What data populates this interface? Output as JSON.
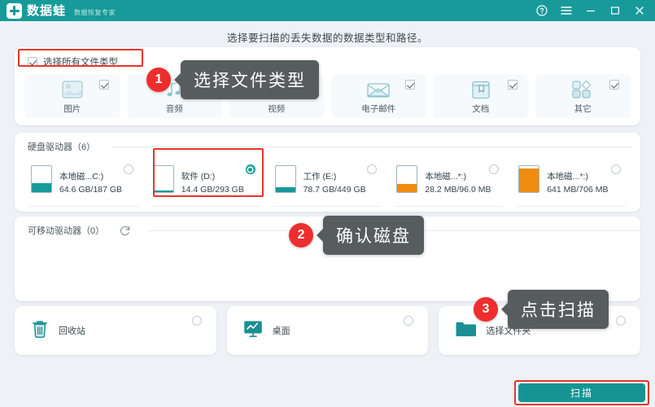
{
  "titlebar": {
    "logo_text": "数据蛙",
    "logo_subtitle": "数据恢复专家",
    "brand_color": "#189a9a",
    "buttons": [
      {
        "name": "help-icon",
        "label": "?"
      },
      {
        "name": "menu-icon",
        "label": "≡"
      },
      {
        "name": "minimize-button",
        "label": "–"
      },
      {
        "name": "maximize-button",
        "label": "□"
      },
      {
        "name": "close-button",
        "label": "✕"
      }
    ]
  },
  "page": {
    "subtitle": "选择要扫描的丢失数据的数据类型和路径。",
    "background": "#eef2f6"
  },
  "filetypes": {
    "select_all_label": "选择所有文件类型",
    "select_all_checked": true,
    "highlight_color": "#e8342a",
    "items": [
      {
        "label": "图片",
        "icon": "image-icon",
        "checked": true
      },
      {
        "label": "音频",
        "icon": "audio-icon",
        "checked": true
      },
      {
        "label": "视频",
        "icon": "video-icon",
        "checked": true
      },
      {
        "label": "电子邮件",
        "icon": "email-icon",
        "checked": true
      },
      {
        "label": "文档",
        "icon": "document-icon",
        "checked": true
      },
      {
        "label": "其它",
        "icon": "other-icon",
        "checked": true
      }
    ]
  },
  "drives": {
    "section_label": "硬盘驱动器（6）",
    "items": [
      {
        "name": "本地磁...C:)",
        "size": "64.6 GB/187 GB",
        "selected": false,
        "fill_pct": 35,
        "fill_color": "#189a9a"
      },
      {
        "name": "软件 (D:)",
        "size": "14.4 GB/293 GB",
        "selected": true,
        "fill_pct": 5,
        "fill_color": "#189a9a"
      },
      {
        "name": "工作 (E:)",
        "size": "78.7 GB/449 GB",
        "selected": false,
        "fill_pct": 18,
        "fill_color": "#189a9a"
      },
      {
        "name": "本地磁...*:)",
        "size": "28.2 MB/96.0 MB",
        "selected": false,
        "fill_pct": 30,
        "fill_color": "#f08c10"
      },
      {
        "name": "本地磁...*:)",
        "size": "641 MB/706 MB",
        "selected": false,
        "fill_pct": 92,
        "fill_color": "#f08c10"
      }
    ]
  },
  "removable": {
    "section_label": "可移动驱动器（0）",
    "refresh_icon": "refresh-icon"
  },
  "locations": [
    {
      "label": "回收站",
      "icon": "recycle-bin-icon",
      "selected": false
    },
    {
      "label": "桌面",
      "icon": "desktop-icon",
      "selected": false
    },
    {
      "label": "选择文件夹",
      "icon": "folder-icon",
      "selected": false
    }
  ],
  "scan": {
    "label": "扫描",
    "color": "#169494",
    "highlight_color": "#e8342a"
  },
  "callouts": [
    {
      "number": "1",
      "text": "选择文件类型"
    },
    {
      "number": "2",
      "text": "确认磁盘"
    },
    {
      "number": "3",
      "text": "点击扫描"
    }
  ]
}
